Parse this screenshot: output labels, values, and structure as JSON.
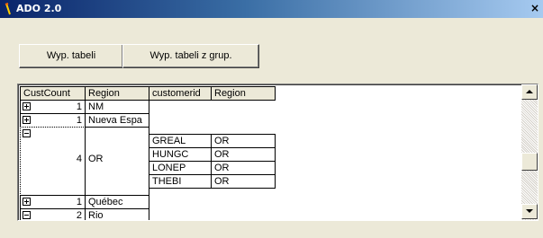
{
  "window": {
    "title": "ADO 2.0",
    "close_label": "×"
  },
  "buttons": {
    "fill_table": "Wyp. tabeli",
    "fill_table_groups": "Wyp. tabeli z grup."
  },
  "grid": {
    "parent_headers": [
      "CustCount",
      "Region"
    ],
    "child_headers": [
      "customerid",
      "Region"
    ],
    "rows": [
      {
        "expander": "plus",
        "custcount": "1",
        "region": "NM"
      },
      {
        "expander": "plus",
        "custcount": "1",
        "region": "Nueva Espa"
      },
      {
        "expander": "minus",
        "custcount": "4",
        "region": "OR",
        "children": [
          {
            "customerid": "GREAL",
            "region": "OR"
          },
          {
            "customerid": "HUNGC",
            "region": "OR"
          },
          {
            "customerid": "LONEP",
            "region": "OR"
          },
          {
            "customerid": "THEBI",
            "region": "OR"
          }
        ]
      },
      {
        "expander": "plus",
        "custcount": "1",
        "region": "Québec"
      },
      {
        "expander": "minus",
        "custcount": "2",
        "region": "Rio"
      }
    ]
  },
  "scrollbar": {
    "up_icon": "triangle-up-icon",
    "down_icon": "triangle-down-icon"
  }
}
